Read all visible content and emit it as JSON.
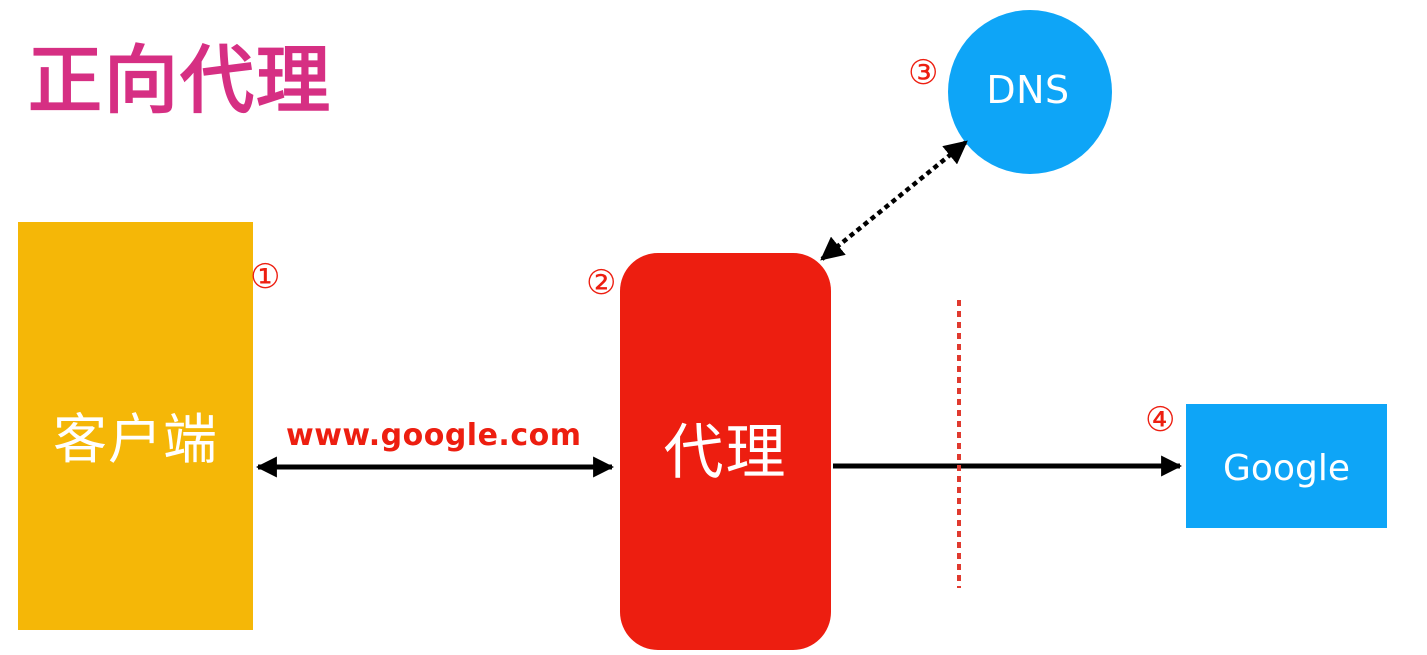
{
  "title": "正向代理",
  "nodes": {
    "client": {
      "label": "客户端",
      "step": "①"
    },
    "proxy": {
      "label": "代理",
      "step": "②"
    },
    "dns": {
      "label": "DNS",
      "step": "③"
    },
    "google": {
      "label": "Google",
      "step": "④"
    }
  },
  "edges": {
    "client_proxy": {
      "label": "www.google.com"
    }
  },
  "colors": {
    "title": "#d62f83",
    "client": "#f5b707",
    "proxy": "#ed1e10",
    "dns": "#0ea5f7",
    "google": "#0ea5f7",
    "step": "#ed1e10",
    "arrow": "#000000",
    "boundary": "#e03a2f"
  }
}
